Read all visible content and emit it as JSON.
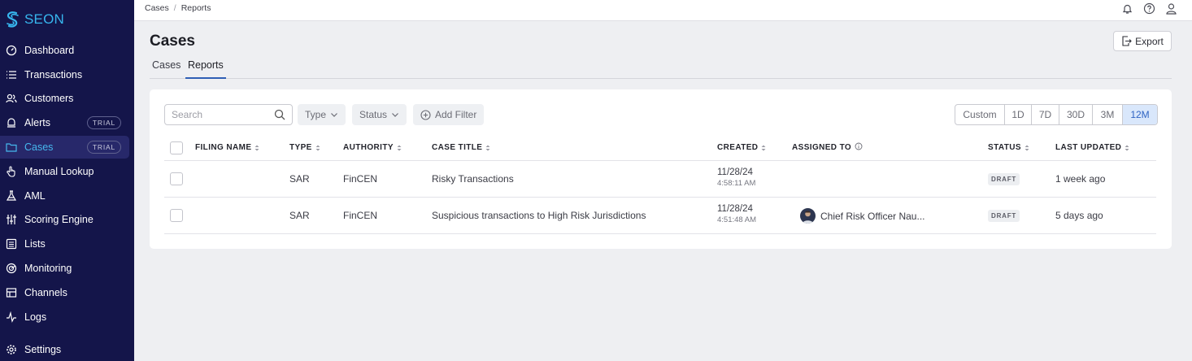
{
  "brand": {
    "name": "SEON"
  },
  "sidebar": {
    "items": [
      {
        "label": "Dashboard",
        "icon": "dashboard-icon"
      },
      {
        "label": "Transactions",
        "icon": "list-icon"
      },
      {
        "label": "Customers",
        "icon": "customers-icon"
      },
      {
        "label": "Alerts",
        "icon": "alert-icon",
        "badge": "TRIAL"
      },
      {
        "label": "Cases",
        "icon": "folder-icon",
        "badge": "TRIAL",
        "active": true
      },
      {
        "label": "Manual Lookup",
        "icon": "hand-pointer-icon"
      },
      {
        "label": "AML",
        "icon": "flask-icon"
      },
      {
        "label": "Scoring Engine",
        "icon": "sliders-icon"
      },
      {
        "label": "Lists",
        "icon": "list-box-icon"
      },
      {
        "label": "Monitoring",
        "icon": "radar-icon"
      },
      {
        "label": "Channels",
        "icon": "channels-icon"
      },
      {
        "label": "Logs",
        "icon": "pulse-icon"
      },
      {
        "label": "Settings",
        "icon": "gear-icon"
      }
    ]
  },
  "breadcrumb": [
    "Cases",
    "Reports"
  ],
  "page": {
    "title": "Cases",
    "export_label": "Export"
  },
  "tabs": [
    {
      "label": "Cases",
      "active": false
    },
    {
      "label": "Reports",
      "active": true
    }
  ],
  "filters": {
    "search_placeholder": "Search",
    "type_label": "Type",
    "status_label": "Status",
    "add_filter_label": "Add Filter",
    "ranges": [
      {
        "label": "Custom",
        "active": false
      },
      {
        "label": "1D",
        "active": false
      },
      {
        "label": "7D",
        "active": false
      },
      {
        "label": "30D",
        "active": false
      },
      {
        "label": "3M",
        "active": false
      },
      {
        "label": "12M",
        "active": true
      }
    ]
  },
  "table": {
    "headers": {
      "filing_name": "FILING NAME",
      "type": "TYPE",
      "authority": "AUTHORITY",
      "case_title": "CASE TITLE",
      "created": "CREATED",
      "assigned_to": "ASSIGNED TO",
      "status": "STATUS",
      "last_updated": "LAST UPDATED"
    },
    "rows": [
      {
        "filing_name": "",
        "type": "SAR",
        "authority": "FinCEN",
        "case_title": "Risky Transactions",
        "created_date": "11/28/24",
        "created_time": "4:58:11 AM",
        "assigned_to": "",
        "status": "DRAFT",
        "last_updated": "1 week ago"
      },
      {
        "filing_name": "",
        "type": "SAR",
        "authority": "FinCEN",
        "case_title": "Suspicious transactions to High Risk Jurisdictions",
        "created_date": "11/28/24",
        "created_time": "4:51:48 AM",
        "assigned_to": "Chief Risk Officer Nau...",
        "status": "DRAFT",
        "last_updated": "5 days ago"
      }
    ]
  },
  "colors": {
    "sidebar_bg": "#14154a",
    "accent": "#46b8ee",
    "active_range": "#2f64c3"
  }
}
